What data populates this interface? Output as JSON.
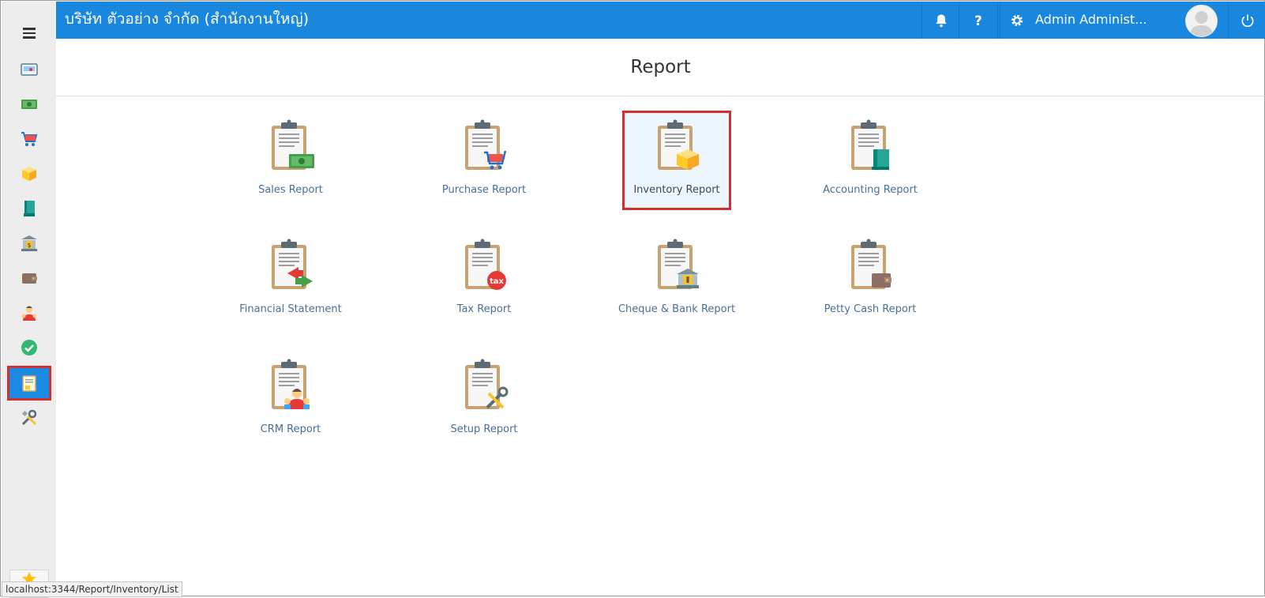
{
  "topbar": {
    "company": "บริษัท ตัวอย่าง จำกัด (สำนักงานใหญ่)",
    "user_name": "Admin Administ...",
    "icons": [
      "bell-icon",
      "help-icon",
      "gear-icon",
      "power-icon"
    ]
  },
  "sidebar": {
    "items": [
      {
        "name": "dashboard",
        "icon": "dashboard-icon"
      },
      {
        "name": "sales",
        "icon": "money-icon"
      },
      {
        "name": "purchase",
        "icon": "cart-icon"
      },
      {
        "name": "inventory",
        "icon": "box-icon"
      },
      {
        "name": "accounting",
        "icon": "book-icon"
      },
      {
        "name": "cheque-bank",
        "icon": "bank-icon"
      },
      {
        "name": "petty-cash",
        "icon": "wallet-icon"
      },
      {
        "name": "crm",
        "icon": "people-icon"
      },
      {
        "name": "approve",
        "icon": "check-icon"
      },
      {
        "name": "report",
        "icon": "report-icon",
        "active": true
      },
      {
        "name": "setup",
        "icon": "tools-icon"
      }
    ]
  },
  "page": {
    "title": "Report"
  },
  "reports": [
    {
      "label": "Sales Report",
      "badge": "money"
    },
    {
      "label": "Purchase Report",
      "badge": "cart"
    },
    {
      "label": "Inventory Report",
      "badge": "box",
      "selected": true
    },
    {
      "label": "Accounting Report",
      "badge": "book"
    },
    {
      "label": "Financial Statement",
      "badge": "exchange"
    },
    {
      "label": "Tax Report",
      "badge": "tax"
    },
    {
      "label": "Cheque & Bank Report",
      "badge": "bank"
    },
    {
      "label": "Petty Cash Report",
      "badge": "wallet"
    },
    {
      "label": "CRM Report",
      "badge": "people"
    },
    {
      "label": "Setup Report",
      "badge": "tools"
    }
  ],
  "tax_badge_text": "tax",
  "status_bar": {
    "url": "localhost:3344/Report/Inventory/List"
  },
  "colors": {
    "topbar": "#1a87de",
    "sidebar": "#ededed",
    "highlight": "#d32f2f",
    "link": "#4a6f96"
  }
}
